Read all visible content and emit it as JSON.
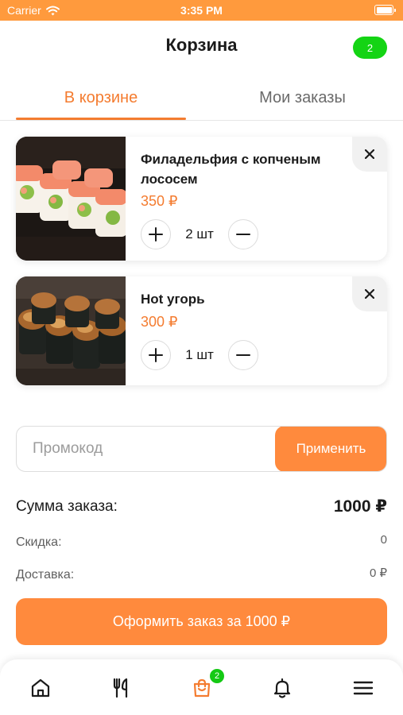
{
  "status_bar": {
    "carrier": "Carrier",
    "time": "3:35 PM"
  },
  "header": {
    "title": "Корзина",
    "badge_count": "2"
  },
  "tabs": [
    {
      "label": "В корзине",
      "active": true
    },
    {
      "label": "Мои заказы",
      "active": false
    }
  ],
  "cart_items": [
    {
      "name": "Филадельфия с копченым лососем",
      "price": "350 ₽",
      "quantity": "2 шт"
    },
    {
      "name": "Hot угорь",
      "price": "300 ₽",
      "quantity": "1 шт"
    }
  ],
  "promo": {
    "placeholder": "Промокод",
    "value": "",
    "apply_label": "Применить"
  },
  "summary": {
    "total_label": "Сумма заказа:",
    "total_value": "1000 ₽",
    "discount_label": "Скидка:",
    "discount_value": "0",
    "delivery_label": "Доставка:",
    "delivery_value": "0 ₽"
  },
  "checkout_label": "Оформить заказ за 1000 ₽",
  "bottom_nav": {
    "items": [
      {
        "icon": "home-icon",
        "active": false
      },
      {
        "icon": "fork-knife-icon",
        "active": false
      },
      {
        "icon": "shopping-bag-icon",
        "active": true
      },
      {
        "icon": "bell-icon",
        "active": false
      },
      {
        "icon": "hamburger-menu-icon",
        "active": false
      }
    ],
    "cart_badge": "2"
  },
  "colors": {
    "accent": "#f47c30",
    "button": "#ff8a3d",
    "status_bar": "#ff9a3d",
    "badge_green": "#14d414"
  }
}
